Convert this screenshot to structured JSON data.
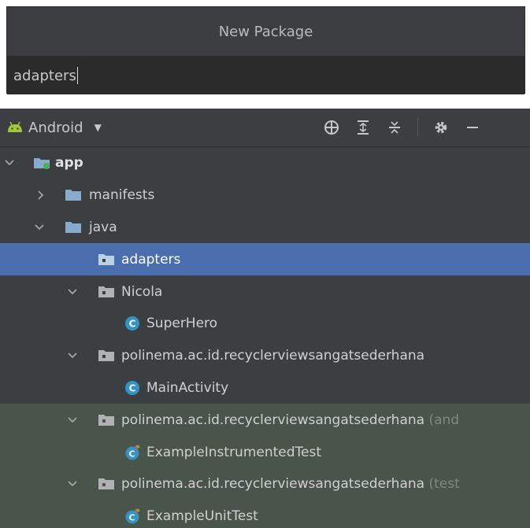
{
  "dialog": {
    "title": "New Package",
    "input_value": "adapters"
  },
  "toolbar": {
    "view_label": "Android",
    "icons": [
      "locate-icon",
      "expand-all-icon",
      "collapse-all-icon",
      "gear-icon",
      "minimize-icon"
    ]
  },
  "tree": {
    "app": "app",
    "manifests": "manifests",
    "java": "java",
    "adapters": "adapters",
    "nicola": "Nicola",
    "superhero": "SuperHero",
    "pkg_main": "polinema.ac.id.recyclerviewsangatsederhana",
    "main_activity": "MainActivity",
    "pkg_android_test": "polinema.ac.id.recyclerviewsangatsederhana",
    "pkg_android_test_suffix": " (and",
    "instrumented_test": "ExampleInstrumentedTest",
    "pkg_unit_test": "polinema.ac.id.recyclerviewsangatsederhana",
    "pkg_unit_test_suffix": " (test",
    "unit_test": "ExampleUnitTest"
  },
  "colors": {
    "selection": "#4b6eaf",
    "test_background": "#49544a",
    "folder": "#87aacd",
    "class_icon": "#3592c4",
    "android_green": "#a4c639"
  }
}
